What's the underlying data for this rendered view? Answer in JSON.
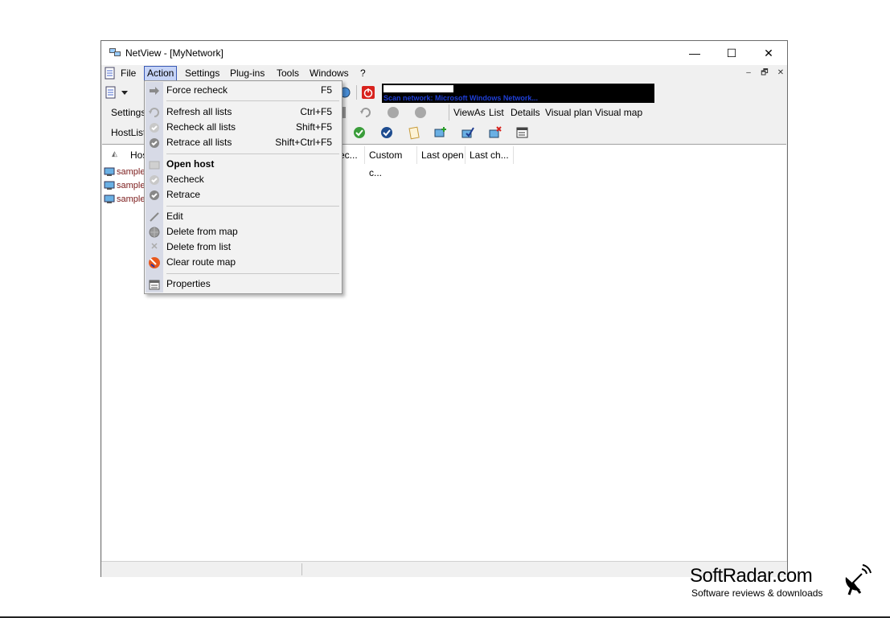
{
  "window": {
    "title": "NetView - [MyNetwork]"
  },
  "caption": {
    "minimize": "—",
    "maximize": "☐",
    "close": "✕"
  },
  "menubar": {
    "file": "File",
    "action": "Action",
    "settings": "Settings",
    "plugins": "Plug-ins",
    "tools": "Tools",
    "windows": "Windows",
    "help": "?"
  },
  "mdi": {
    "min": "–",
    "restore": "🗗",
    "close": "✕"
  },
  "toolbar": {
    "info": "Scan network: Microsoft Windows Network...",
    "settings": "Settings",
    "hostlist": "HostList",
    "viewas": "ViewAs",
    "list": "List",
    "details": "Details",
    "visual_plan": "Visual plan",
    "visual_map": "Visual map"
  },
  "columns": [
    "Hos",
    "ec...",
    "Custom c...",
    "Last open",
    "Last ch..."
  ],
  "hosts": [
    "sample_",
    "sample_",
    "sample_"
  ],
  "action_menu": {
    "force_recheck": {
      "label": "Force recheck",
      "shortcut": "F5"
    },
    "refresh_all": {
      "label": "Refresh all lists",
      "shortcut": "Ctrl+F5"
    },
    "recheck_all": {
      "label": "Recheck all lists",
      "shortcut": "Shift+F5"
    },
    "retrace_all": {
      "label": "Retrace all lists",
      "shortcut": "Shift+Ctrl+F5"
    },
    "open_host": {
      "label": "Open host"
    },
    "recheck": {
      "label": "Recheck"
    },
    "retrace": {
      "label": "Retrace"
    },
    "edit": {
      "label": "Edit"
    },
    "delete_map": {
      "label": "Delete from map"
    },
    "delete_list": {
      "label": "Delete from list"
    },
    "clear_route": {
      "label": "Clear route map"
    },
    "properties": {
      "label": "Properties"
    }
  },
  "watermark": {
    "brand": "SoftRadar.com",
    "tagline": "Software reviews & downloads"
  },
  "colors": {
    "menu_highlight": "#c6d4f7",
    "menu_stripe": "#d7dae6",
    "host_text": "#7a1a1a",
    "scan_bar": "#000000",
    "scan_text": "#1f3fd8"
  }
}
